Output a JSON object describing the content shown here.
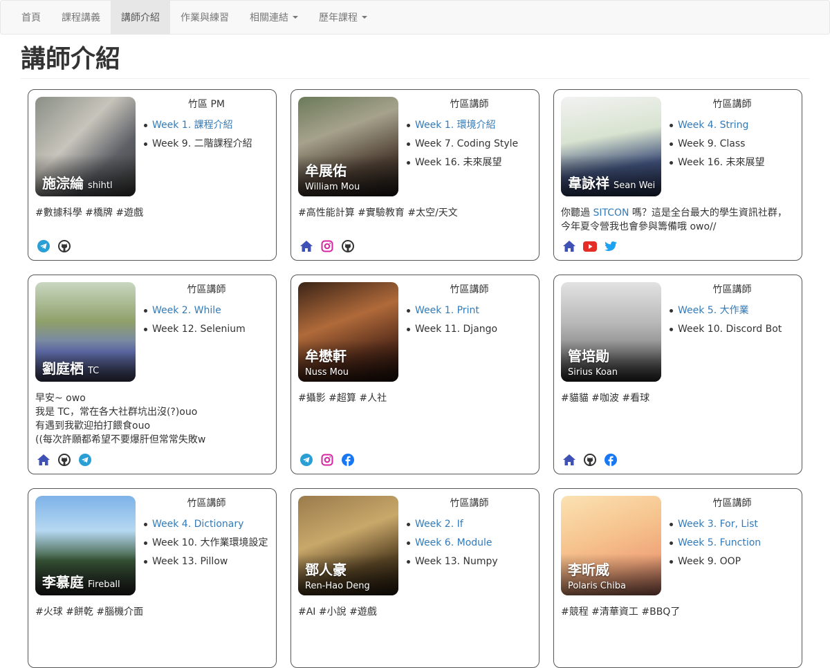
{
  "nav": {
    "items": [
      {
        "label": "首頁",
        "active": false,
        "dropdown": false
      },
      {
        "label": "課程講義",
        "active": false,
        "dropdown": false
      },
      {
        "label": "講師介紹",
        "active": true,
        "dropdown": false
      },
      {
        "label": "作業與練習",
        "active": false,
        "dropdown": false
      },
      {
        "label": "相關連結",
        "active": false,
        "dropdown": true
      },
      {
        "label": "歷年課程",
        "active": false,
        "dropdown": true
      }
    ]
  },
  "page_title": "講師介紹",
  "cards": [
    {
      "name": "施淙綸",
      "nick": "shihtl",
      "english": "",
      "role": "竹區 PM",
      "weeks": [
        {
          "text": "Week 1. 課程介紹",
          "link": true
        },
        {
          "text": "Week 9. 二階課程介紹",
          "link": false
        }
      ],
      "desc": [
        "#數據科學 #橋牌 #遊戲"
      ],
      "icons": [
        "telegram-icon",
        "github-icon"
      ]
    },
    {
      "name": "牟展佑",
      "nick": "",
      "english": "William Mou",
      "role": "竹區講師",
      "weeks": [
        {
          "text": "Week 1. 環境介紹",
          "link": true
        },
        {
          "text": "Week 7. Coding Style",
          "link": false
        },
        {
          "text": "Week 16. 未來展望",
          "link": false
        }
      ],
      "desc": [
        "#高性能計算 #實驗教育 #太空/天文"
      ],
      "icons": [
        "home-icon",
        "instagram-icon",
        "github-icon"
      ]
    },
    {
      "name": "韋詠祥",
      "nick": "Sean Wei",
      "english": "",
      "role": "竹區講師",
      "weeks": [
        {
          "text": "Week 4. String",
          "link": true
        },
        {
          "text": "Week 9. Class",
          "link": false
        },
        {
          "text": "Week 16. 未來展望",
          "link": false
        }
      ],
      "desc_pre": "你聽過 ",
      "desc_link": "SITCON",
      "desc_post": " 嗎？這是全台最大的學生資訊社群，",
      "desc": [
        "今年夏令營我也會參與籌備哦 owo//"
      ],
      "icons": [
        "home-icon",
        "youtube-icon",
        "twitter-icon"
      ]
    },
    {
      "name": "劉庭栖",
      "nick": "TC",
      "english": "",
      "role": "竹區講師",
      "weeks": [
        {
          "text": "Week 2. While",
          "link": true
        },
        {
          "text": "Week 12. Selenium",
          "link": false
        }
      ],
      "desc": [
        "早安~ owo",
        "我是 TC，常在各大社群坑出沒(?)ouo",
        "有遇到我歡迎拍打餵食ouo",
        "((每次許願都希望不要爆肝但常常失敗w"
      ],
      "icons": [
        "home-icon",
        "github-icon",
        "telegram-icon"
      ]
    },
    {
      "name": "牟懋軒",
      "nick": "",
      "english": "Nuss Mou",
      "role": "竹區講師",
      "weeks": [
        {
          "text": "Week 1. Print",
          "link": true
        },
        {
          "text": "Week 11. Django",
          "link": false
        }
      ],
      "desc": [
        "#攝影 #超算 #人社"
      ],
      "icons": [
        "telegram-icon",
        "instagram-icon",
        "facebook-icon"
      ]
    },
    {
      "name": "管培勛",
      "nick": "",
      "english": "Sirius Koan",
      "role": "竹區講師",
      "weeks": [
        {
          "text": "Week 5. 大作業",
          "link": true
        },
        {
          "text": "Week 10. Discord Bot",
          "link": false
        }
      ],
      "desc": [
        "#貓貓 #咖波 #看球"
      ],
      "icons": [
        "home-icon",
        "github-icon",
        "facebook-icon"
      ]
    },
    {
      "name": "李慕庭",
      "nick": "Fireball",
      "english": "",
      "role": "竹區講師",
      "weeks": [
        {
          "text": "Week 4. Dictionary",
          "link": true
        },
        {
          "text": "Week 10. 大作業環境設定",
          "link": false
        },
        {
          "text": "Week 13. Pillow",
          "link": false
        }
      ],
      "desc": [
        "#火球 #餅乾 #腦機介面"
      ],
      "icons": []
    },
    {
      "name": "鄧人豪",
      "nick": "",
      "english": "Ren-Hao Deng",
      "role": "竹區講師",
      "weeks": [
        {
          "text": "Week 2. If",
          "link": true
        },
        {
          "text": "Week 6. Module",
          "link": true
        },
        {
          "text": "Week 13. Numpy",
          "link": false
        }
      ],
      "desc": [
        "#AI #小說 #遊戲"
      ],
      "icons": []
    },
    {
      "name": "李昕威",
      "nick": "",
      "english": "Polaris Chiba",
      "role": "竹區講師",
      "weeks": [
        {
          "text": "Week 3. For, List",
          "link": true
        },
        {
          "text": "Week 5. Function",
          "link": true
        },
        {
          "text": "Week 9. OOP",
          "link": false
        }
      ],
      "desc": [
        "#競程 #清華資工 #BBQ了"
      ],
      "icons": []
    }
  ],
  "colors": {
    "link": "#337ab7",
    "home": "#3f51b5",
    "telegram": "#2a9fd6",
    "instagram": "#d6249f",
    "github": "#333333",
    "youtube": "#e52d27",
    "twitter": "#1da1f2",
    "facebook": "#1877f2"
  }
}
